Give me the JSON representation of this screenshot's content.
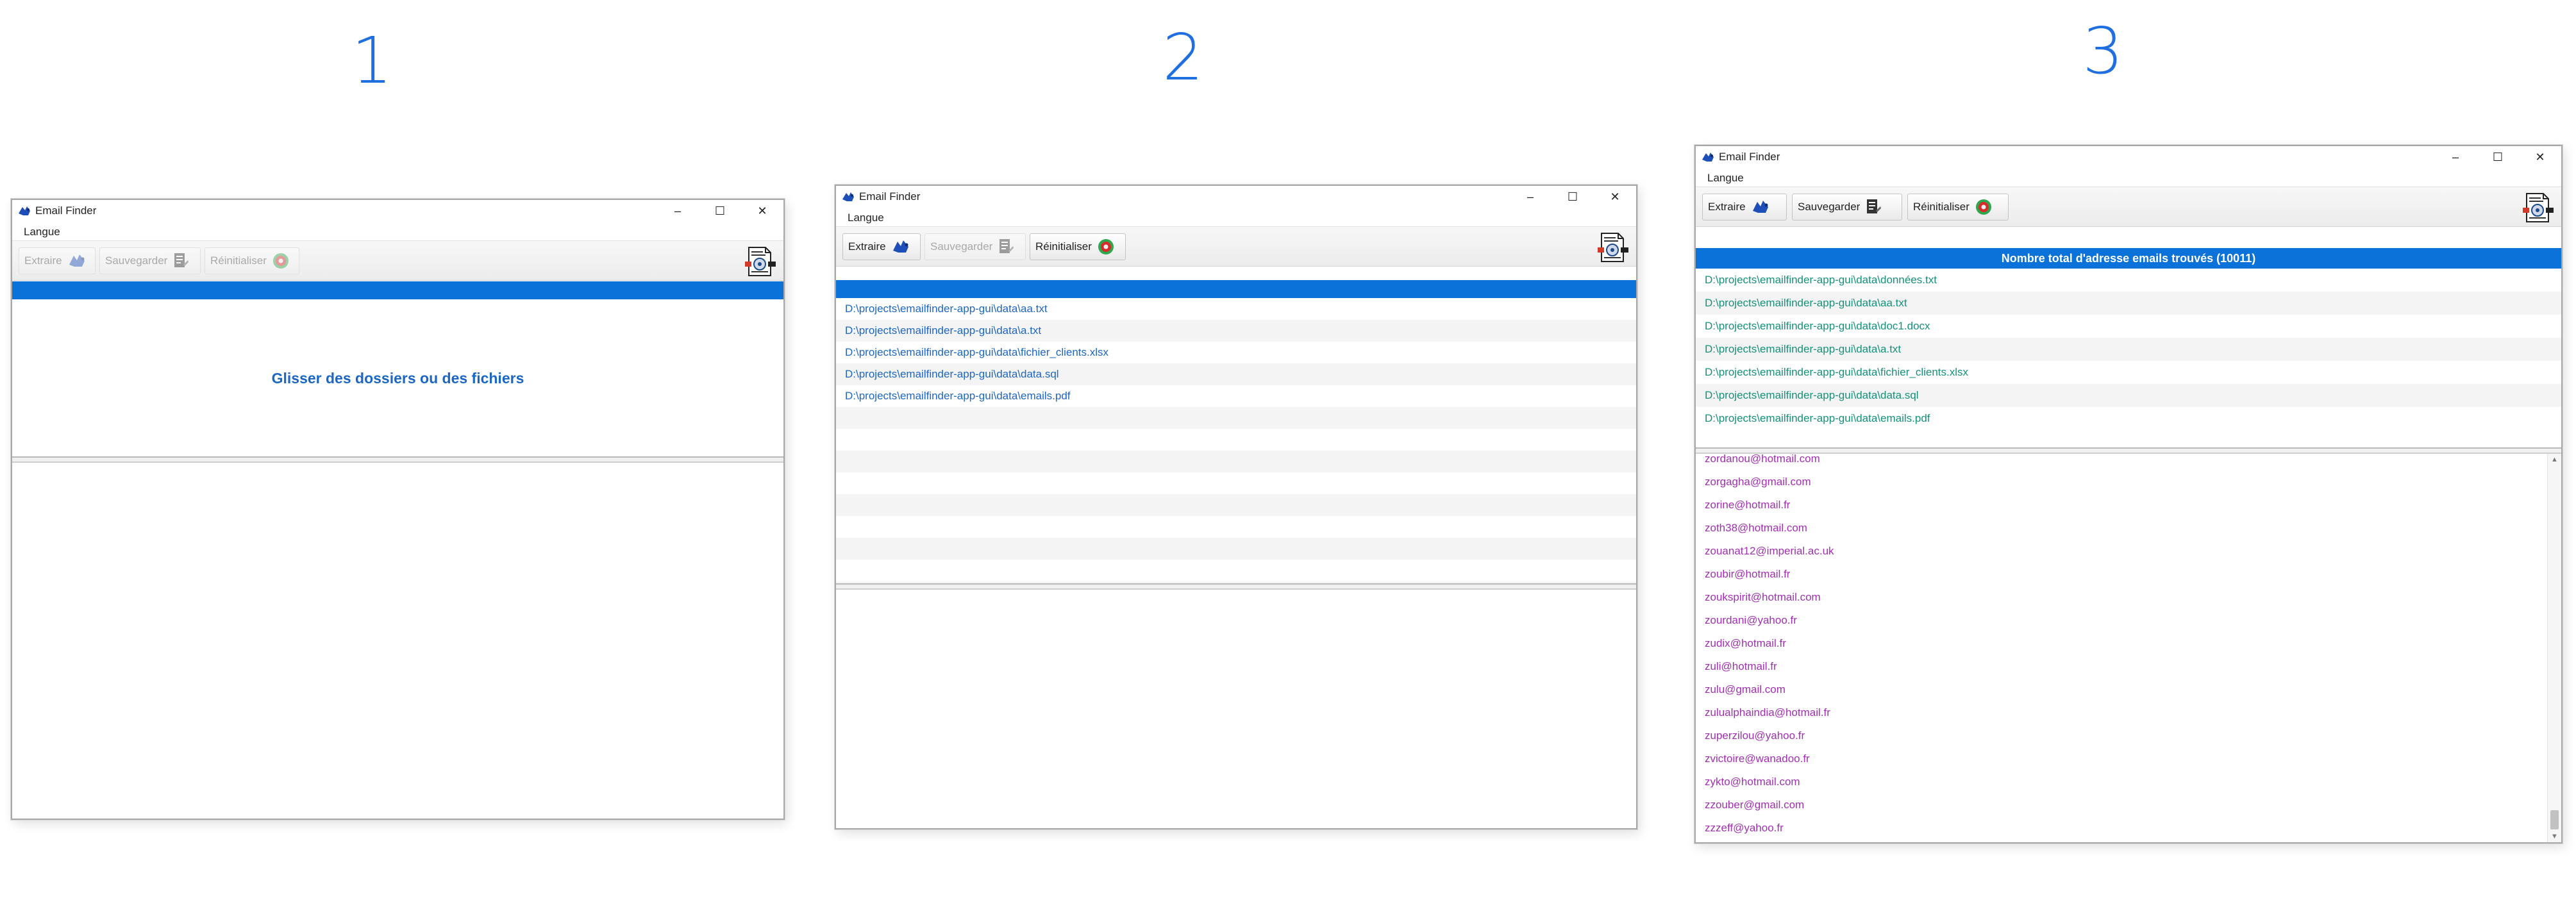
{
  "steps": [
    "1",
    "2",
    "3"
  ],
  "app": {
    "title": "Email Finder",
    "menu_language": "Langue",
    "buttons": {
      "extract": "Extraire",
      "save": "Sauvegarder",
      "reset": "Réinitialiser"
    },
    "window_controls": {
      "minimize": "–",
      "maximize": "☐",
      "close": "✕"
    }
  },
  "window1": {
    "drop_text": "Glisser des dossiers ou des fichiers"
  },
  "window2": {
    "files": [
      "D:\\projects\\emailfinder-app-gui\\data\\aa.txt",
      "D:\\projects\\emailfinder-app-gui\\data\\a.txt",
      "D:\\projects\\emailfinder-app-gui\\data\\fichier_clients.xlsx",
      "D:\\projects\\emailfinder-app-gui\\data\\data.sql",
      "D:\\projects\\emailfinder-app-gui\\data\\emails.pdf"
    ]
  },
  "window3": {
    "header": "Nombre total d'adresse emails trouvés (10011)",
    "files": [
      "D:\\projects\\emailfinder-app-gui\\data\\données.txt",
      "D:\\projects\\emailfinder-app-gui\\data\\aa.txt",
      "D:\\projects\\emailfinder-app-gui\\data\\doc1.docx",
      "D:\\projects\\emailfinder-app-gui\\data\\a.txt",
      "D:\\projects\\emailfinder-app-gui\\data\\fichier_clients.xlsx",
      "D:\\projects\\emailfinder-app-gui\\data\\data.sql",
      "D:\\projects\\emailfinder-app-gui\\data\\emails.pdf"
    ],
    "emails": [
      "zordanou@hotmail.com",
      "zorgagha@gmail.com",
      "zorine@hotmail.fr",
      "zoth38@hotmail.com",
      "zouanat12@imperial.ac.uk",
      "zoubir@hotmail.fr",
      "zoukspirit@hotmail.com",
      "zourdani@yahoo.fr",
      "zudix@hotmail.fr",
      "zuli@hotmail.fr",
      "zulu@gmail.com",
      "zulualphaindia@hotmail.fr",
      "zuperzilou@yahoo.fr",
      "zvictoire@wanadoo.fr",
      "zykto@hotmail.com",
      "zzouber@gmail.com",
      "zzzeff@yahoo.fr"
    ]
  },
  "colors": {
    "accent": "#0a72d8",
    "step_number": "#1f6fe0",
    "file_link": "#1c66c4",
    "file_done": "#16907a",
    "email": "#a030b0"
  },
  "icons": [
    "app-logo-icon",
    "extract-icon",
    "save-icon",
    "reset-icon",
    "export-document-icon"
  ]
}
